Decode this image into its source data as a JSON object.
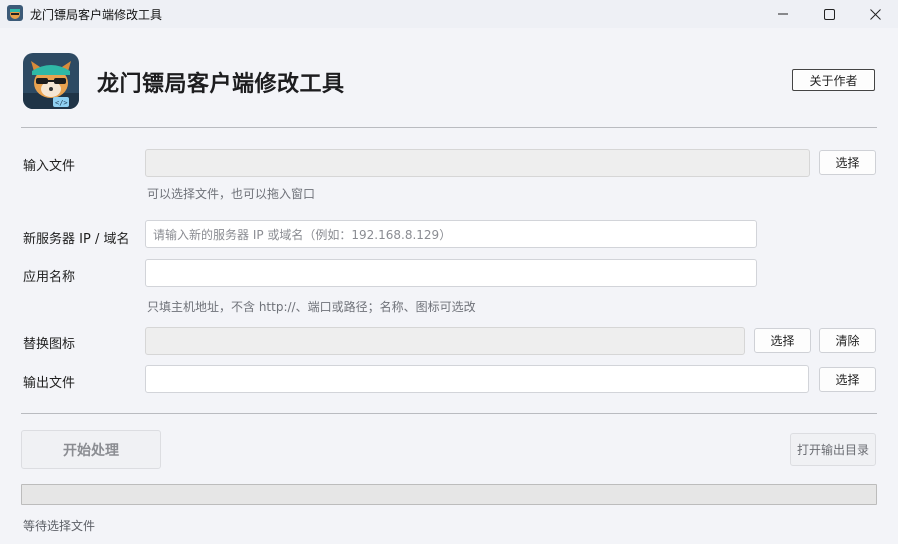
{
  "window": {
    "title": "龙门镖局客户端修改工具",
    "minimize_icon": "minimize-icon",
    "maximize_icon": "maximize-icon",
    "close_icon": "close-icon"
  },
  "header": {
    "logo_icon": "app-logo-raccoon-icon",
    "title": "龙门镖局客户端修改工具",
    "about_button": "关于作者"
  },
  "form": {
    "input_file": {
      "label": "输入文件",
      "value": "",
      "select_button": "选择",
      "hint": "可以选择文件，也可以拖入窗口"
    },
    "server": {
      "label": "新服务器 IP / 域名",
      "value": "",
      "placeholder": "请输入新的服务器 IP 或域名（例如：192.168.8.129）"
    },
    "app_name": {
      "label": "应用名称",
      "value": "",
      "hint": "只填主机地址，不含 http://、端口或路径；名称、图标可选改"
    },
    "icon": {
      "label": "替换图标",
      "value": "",
      "select_button": "选择",
      "clear_button": "清除"
    },
    "output_file": {
      "label": "输出文件",
      "value": "",
      "select_button": "选择"
    }
  },
  "actions": {
    "start_button": "开始处理",
    "open_output_button": "打开输出目录"
  },
  "progress": {
    "value": 0,
    "fill_color": "#06b025"
  },
  "status": "等待选择文件"
}
